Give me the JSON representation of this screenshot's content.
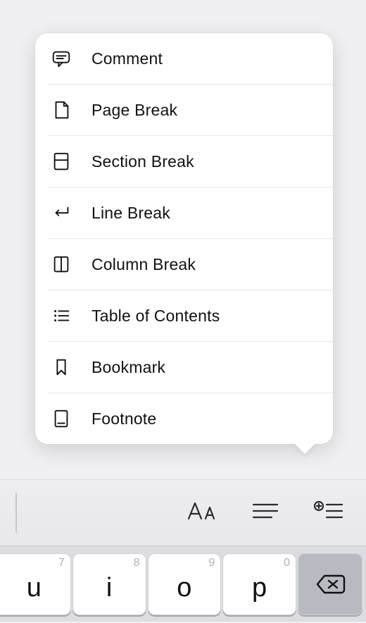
{
  "menu": {
    "items": [
      {
        "id": "comment",
        "label": "Comment",
        "icon": "comment-icon"
      },
      {
        "id": "page-break",
        "label": "Page Break",
        "icon": "page-break-icon"
      },
      {
        "id": "section-break",
        "label": "Section Break",
        "icon": "section-break-icon"
      },
      {
        "id": "line-break",
        "label": "Line Break",
        "icon": "line-break-icon"
      },
      {
        "id": "column-break",
        "label": "Column Break",
        "icon": "column-break-icon"
      },
      {
        "id": "toc",
        "label": "Table of Contents",
        "icon": "list-icon"
      },
      {
        "id": "bookmark",
        "label": "Bookmark",
        "icon": "bookmark-icon"
      },
      {
        "id": "footnote",
        "label": "Footnote",
        "icon": "footnote-icon"
      }
    ]
  },
  "toolbar": {
    "buttons": [
      {
        "id": "format-text",
        "icon": "text-format-icon"
      },
      {
        "id": "paragraph",
        "icon": "paragraph-icon"
      },
      {
        "id": "insert",
        "icon": "insert-list-icon"
      }
    ]
  },
  "keyboard": {
    "keys": [
      {
        "hint": "7",
        "glyph": "u"
      },
      {
        "hint": "8",
        "glyph": "i"
      },
      {
        "hint": "9",
        "glyph": "o"
      },
      {
        "hint": "0",
        "glyph": "p"
      }
    ],
    "delete_icon": "delete-icon"
  }
}
